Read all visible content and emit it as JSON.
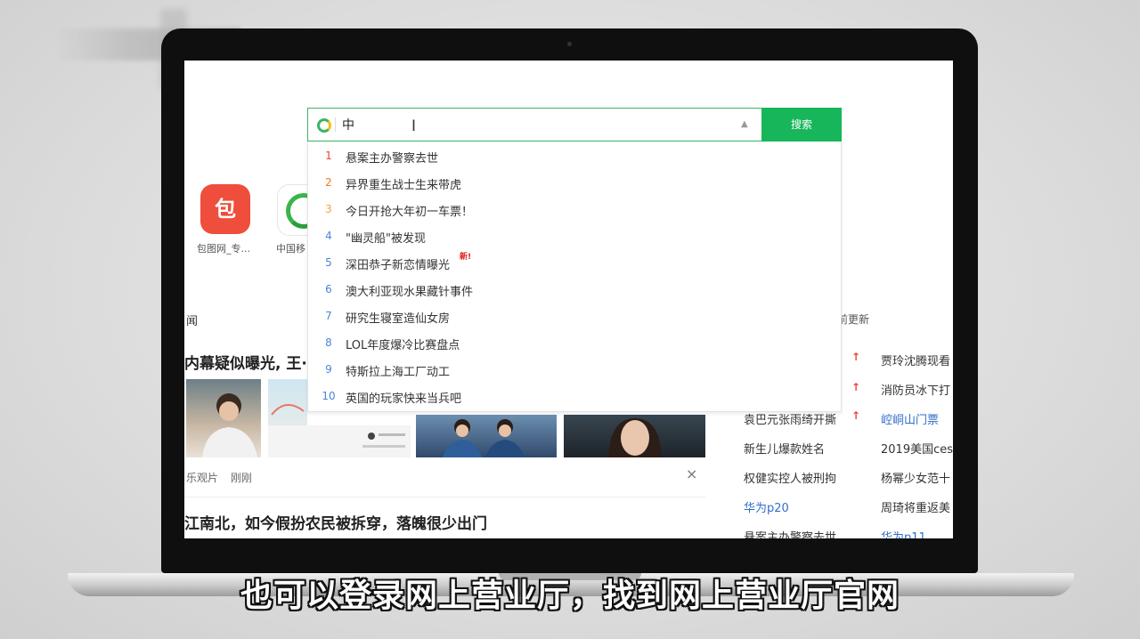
{
  "search": {
    "value": "中",
    "button_label": "搜索"
  },
  "suggestions": [
    {
      "rank": "1",
      "text": "悬案主办警察去世",
      "color": "#e8473a"
    },
    {
      "rank": "2",
      "text": "异界重生战士生来带虎",
      "color": "#f07b1d"
    },
    {
      "rank": "3",
      "text": "今日开抢大年初一车票！",
      "color": "#f2a33a"
    },
    {
      "rank": "4",
      "text": "\"幽灵船\"被发现",
      "color": "#4a86d8"
    },
    {
      "rank": "5",
      "text": "深田恭子新恋情曝光",
      "color": "#4a86d8",
      "badge": "新!"
    },
    {
      "rank": "6",
      "text": "澳大利亚现水果藏针事件",
      "color": "#4a86d8"
    },
    {
      "rank": "7",
      "text": "研究生寝室造仙女房",
      "color": "#4a86d8"
    },
    {
      "rank": "8",
      "text": "LOL年度爆冷比赛盘点",
      "color": "#4a86d8"
    },
    {
      "rank": "9",
      "text": "特斯拉上海工厂动工",
      "color": "#4a86d8"
    },
    {
      "rank": "10",
      "text": "英国的玩家快来当兵吧",
      "color": "#4a86d8"
    }
  ],
  "apps": [
    {
      "glyph": "包",
      "label": "包图网_专..."
    },
    {
      "label": "中国移"
    }
  ],
  "news": {
    "section_label": "闻",
    "update_note": "前更新",
    "headline1": "内幕疑似曝光, 王·",
    "meta_source": "乐观片",
    "meta_time": "刚刚",
    "close_glyph": "×",
    "headline2": "江南北，如今假扮农民被拆穿，落魄很少出门"
  },
  "hot_list": {
    "col1": [
      "袁巴元张雨绮开撕",
      "新生儿爆款姓名",
      "权健实控人被刑拘",
      "华为p20",
      "悬案主办警察去世"
    ],
    "col2": [
      "贾玲沈腾现看",
      "消防员冰下打",
      "崆峒山门票",
      "2019美国ces",
      "杨幂少女范十",
      "周琦将重返美",
      "华为p11"
    ]
  },
  "subtitle": "也可以登录网上营业厅，找到网上营业厅官网",
  "colors": {
    "accent_green": "#17b65a",
    "border_green": "#3cb563",
    "hot_red": "#e8473a",
    "link_blue": "#2f6fc9"
  }
}
